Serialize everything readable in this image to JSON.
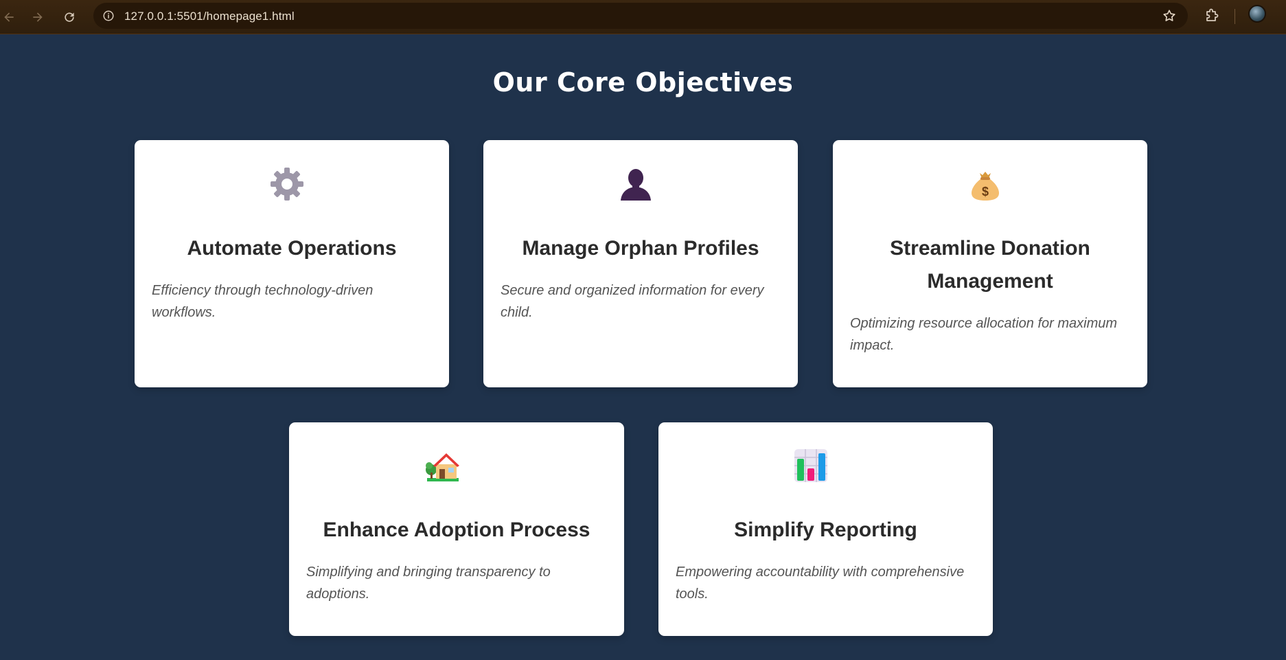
{
  "browser": {
    "url": "127.0.0.1:5501/homepage1.html"
  },
  "page": {
    "heading": "Our Core Objectives"
  },
  "cards": [
    {
      "icon": "gear-icon",
      "title": "Automate Operations",
      "description": "Efficiency through technology-driven workflows."
    },
    {
      "icon": "person-silhouette-icon",
      "title": "Manage Orphan Profiles",
      "description": "Secure and organized information for every child."
    },
    {
      "icon": "money-bag-icon",
      "title": "Streamline Donation Management",
      "description": "Optimizing resource allocation for maximum impact."
    },
    {
      "icon": "house-with-garden-icon",
      "title": "Enhance Adoption Process",
      "description": "Simplifying and bringing transparency to adoptions."
    },
    {
      "icon": "bar-chart-icon",
      "title": "Simplify Reporting",
      "description": "Empowering accountability with comprehensive tools."
    }
  ],
  "colors": {
    "page_background": "#1f324b",
    "card_background": "#ffffff",
    "title_text": "#2b2b2b",
    "description_text": "#555555"
  }
}
